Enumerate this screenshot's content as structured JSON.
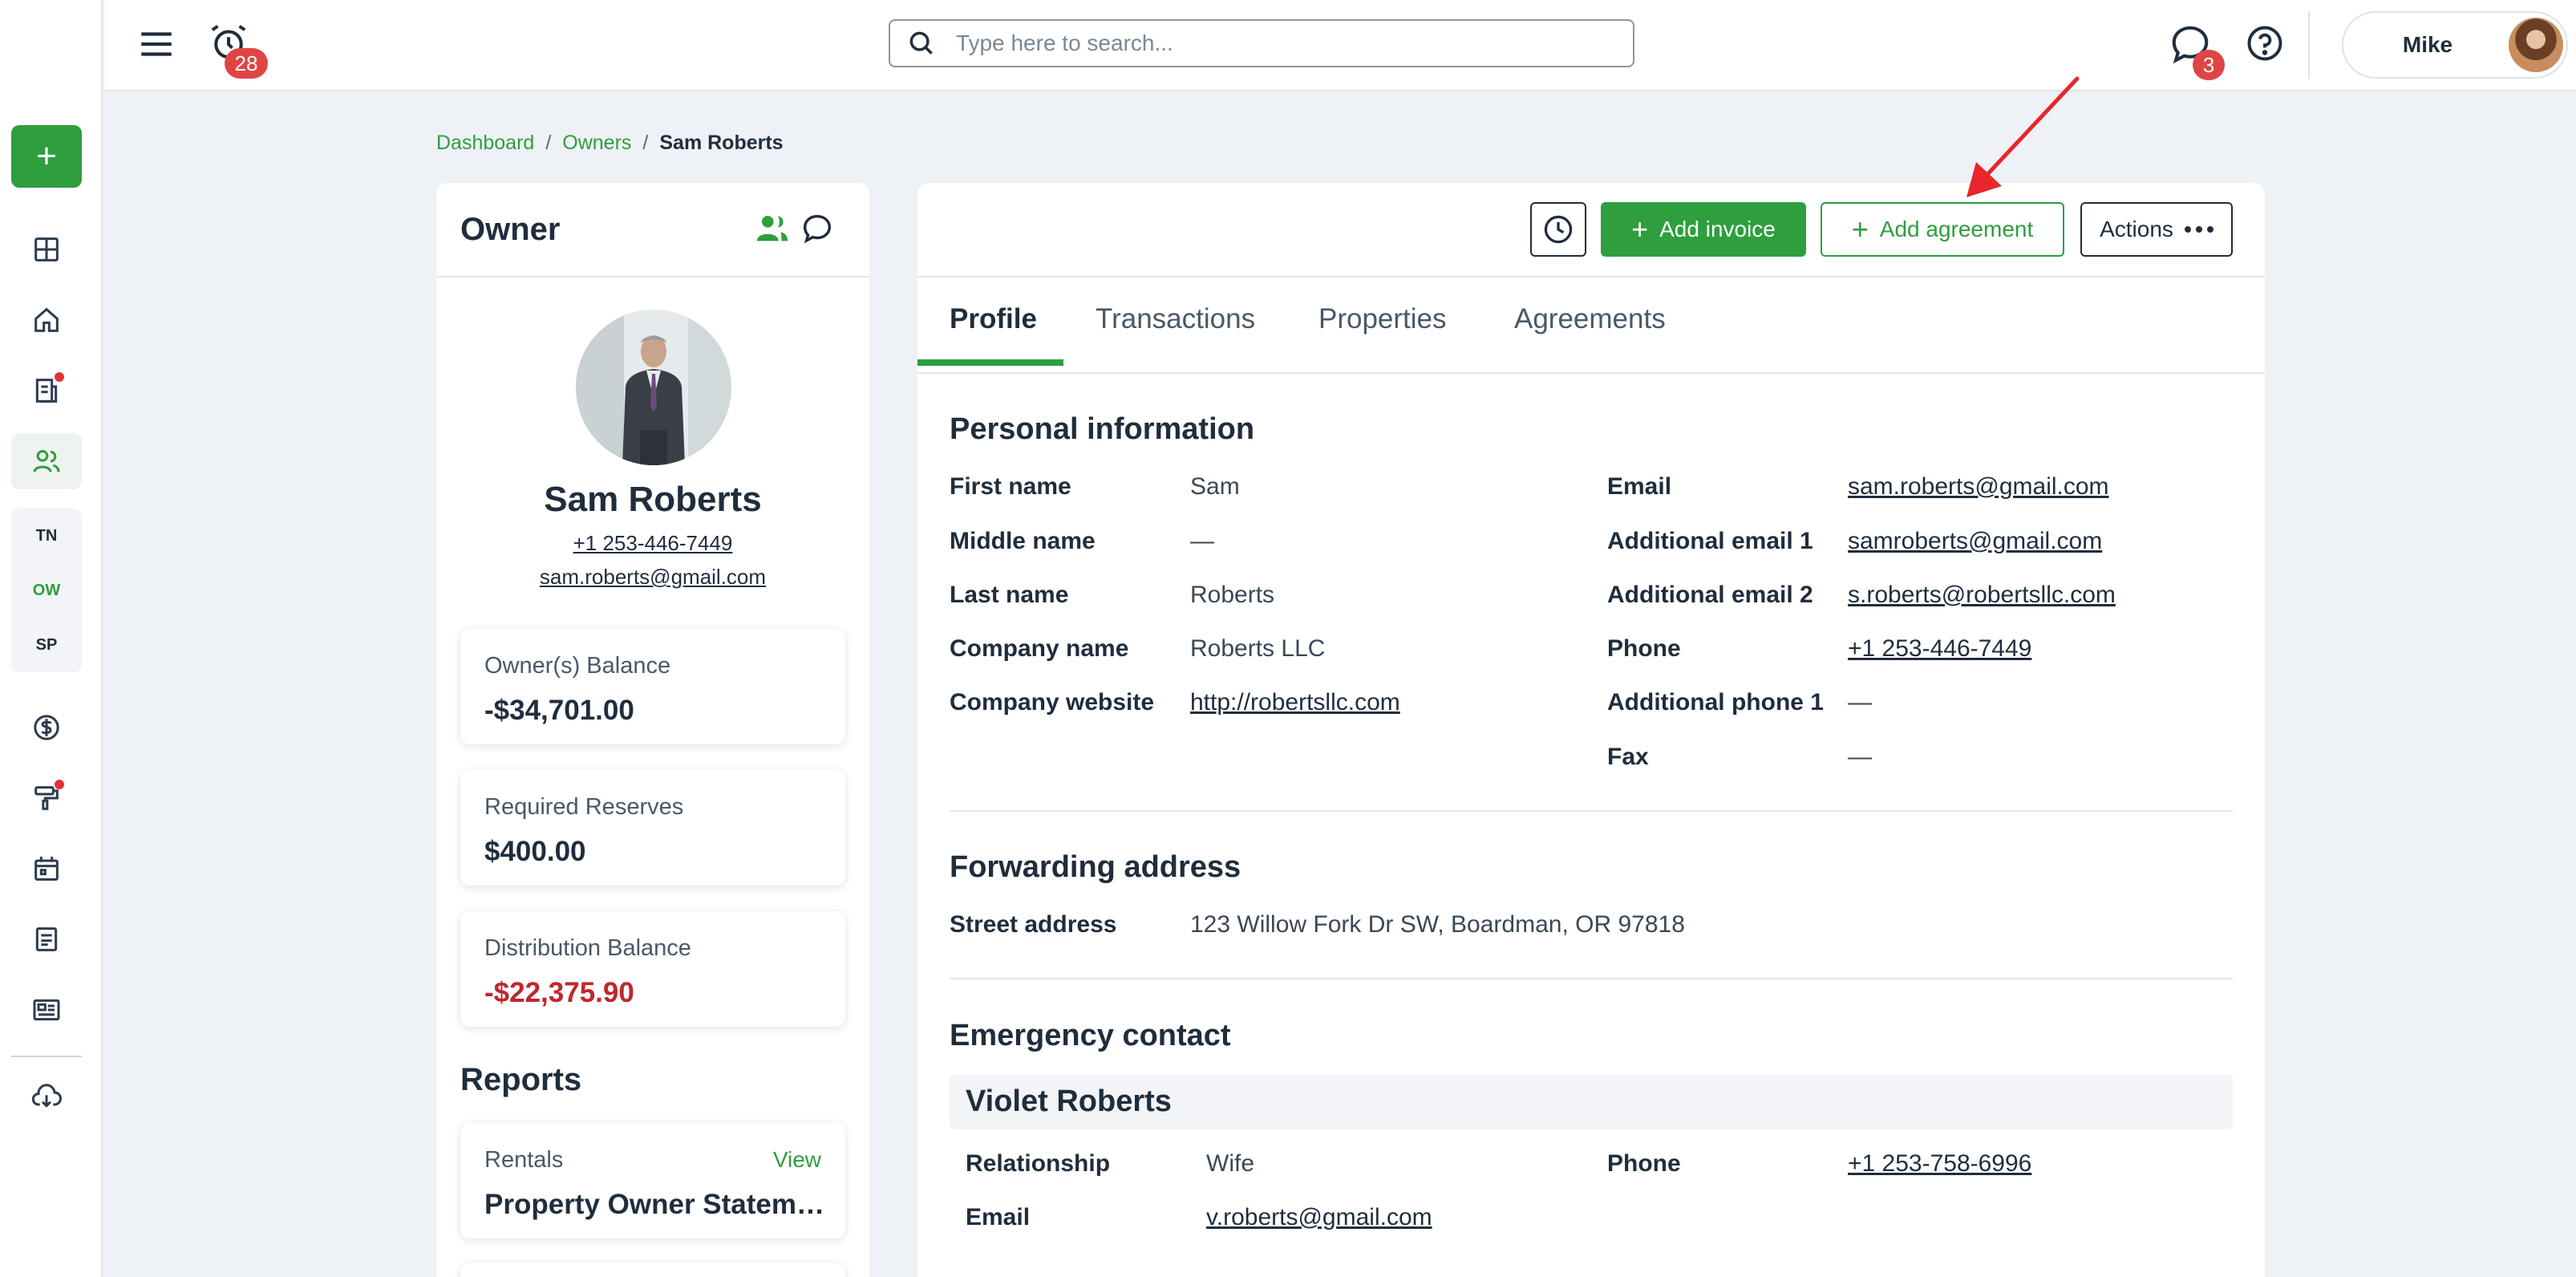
{
  "topbar": {
    "alarm_count": "28",
    "search_placeholder": "Type here to search...",
    "chat_count": "3",
    "user_name": "Mike"
  },
  "rail": {
    "add_label": "+",
    "sub_items": [
      "TN",
      "OW",
      "SP"
    ]
  },
  "breadcrumb": {
    "items": [
      "Dashboard",
      "Owners"
    ],
    "separator": "/",
    "current": "Sam Roberts"
  },
  "owner_panel": {
    "title": "Owner",
    "name": "Sam Roberts",
    "phone": "+1 253-446-7449",
    "email": "sam.roberts@gmail.com",
    "balances": [
      {
        "label": "Owner(s) Balance",
        "value": "-$34,701.00",
        "negative": false
      },
      {
        "label": "Required Reserves",
        "value": "$400.00",
        "negative": false
      },
      {
        "label": "Distribution Balance",
        "value": "-$22,375.90",
        "negative": true
      }
    ],
    "reports_title": "Reports",
    "report": {
      "category": "Rentals",
      "view_label": "View",
      "name": "Property Owner Statement"
    }
  },
  "toolbar": {
    "add_invoice": "Add invoice",
    "add_agreement": "Add agreement",
    "actions": "Actions"
  },
  "tabs": [
    "Profile",
    "Transactions",
    "Properties",
    "Agreements"
  ],
  "personal": {
    "title": "Personal information",
    "left": [
      {
        "label": "First name",
        "value": "Sam"
      },
      {
        "label": "Middle name",
        "value": "—"
      },
      {
        "label": "Last name",
        "value": "Roberts"
      },
      {
        "label": "Company name",
        "value": "Roberts LLC"
      },
      {
        "label": "Company website",
        "value": "http://robertsllc.com"
      }
    ],
    "right": [
      {
        "label": "Email",
        "value": "sam.roberts@gmail.com"
      },
      {
        "label": "Additional email 1",
        "value": "samroberts@gmail.com"
      },
      {
        "label": "Additional email 2",
        "value": "s.roberts@robertsllc.com"
      },
      {
        "label": "Phone",
        "value": "+1 253-446-7449"
      },
      {
        "label": "Additional phone 1",
        "value": "—"
      },
      {
        "label": "Fax",
        "value": "—"
      }
    ]
  },
  "forwarding": {
    "title": "Forwarding address",
    "label": "Street address",
    "value": "123 Willow Fork Dr SW, Boardman, OR 97818"
  },
  "emergency": {
    "title": "Emergency contact",
    "name": "Violet Roberts",
    "relationship_label": "Relationship",
    "relationship": "Wife",
    "phone_label": "Phone",
    "phone": "+1 253-758-6996",
    "email_label": "Email",
    "email": "v.roberts@gmail.com"
  },
  "colors": {
    "brand_green": "#2e9e3e",
    "negative_red": "#c0262d",
    "badge_red": "#e04545",
    "arrow_red": "#e8262c"
  }
}
